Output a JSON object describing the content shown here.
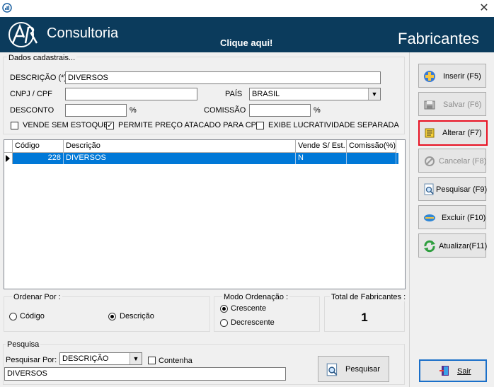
{
  "header": {
    "brand": "Consultoria",
    "cta": "Clique aqui!",
    "title": "Fabricantes"
  },
  "form": {
    "section": "Dados cadastrais...",
    "descricao_label": "DESCRIÇÃO (*)",
    "descricao_value": "DIVERSOS",
    "cnpj_label": "CNPJ / CPF",
    "cnpj_value": "",
    "pais_label": "PAÍS",
    "pais_value": "BRASIL",
    "desconto_label": "DESCONTO",
    "desconto_value": "",
    "desconto_unit": "%",
    "comissao_label": "COMISSÃO",
    "comissao_value": "",
    "comissao_unit": "%",
    "chk_vende": "VENDE SEM ESTOQUE",
    "chk_vende_checked": false,
    "chk_atacado": "PERMITE PREÇO ATACADO PARA CPF",
    "chk_atacado_checked": true,
    "chk_lucro": "EXIBE LUCRATIVIDADE SEPARADA",
    "chk_lucro_checked": false
  },
  "grid": {
    "columns": [
      "Código",
      "Descrição",
      "Vende S/ Est.",
      "Comissão(%)"
    ],
    "rows": [
      {
        "codigo": "228",
        "descricao": "DIVERSOS",
        "vende": "N",
        "comissao": ""
      }
    ]
  },
  "ordenar": {
    "title": "Ordenar Por :",
    "opt_codigo": "Código",
    "opt_descricao": "Descrição",
    "selected": "Descrição"
  },
  "modo": {
    "title": "Modo Ordenação :",
    "opt_cresc": "Crescente",
    "opt_decresc": "Decrescente",
    "selected": "Crescente"
  },
  "total": {
    "title": "Total de Fabricantes :",
    "value": "1"
  },
  "pesquisa": {
    "section": "Pesquisa",
    "por_label": "Pesquisar Por:",
    "por_value": "DESCRIÇÃO",
    "contenha_label": "Contenha",
    "contenha_checked": false,
    "text_value": "DIVERSOS",
    "button": "Pesquisar"
  },
  "sidebar": {
    "inserir": "Inserir (F5)",
    "salvar": "Salvar (F6)",
    "alterar": "Alterar (F7)",
    "cancelar": "Cancelar (F8)",
    "pesquisar": "Pesquisar (F9)",
    "excluir": "Excluir (F10)",
    "atualizar": "Atualizar(F11)",
    "sair": "Sair"
  },
  "colors": {
    "header_bg": "#0b3b5c",
    "selection": "#0078d7",
    "highlight_border": "#e81123"
  }
}
